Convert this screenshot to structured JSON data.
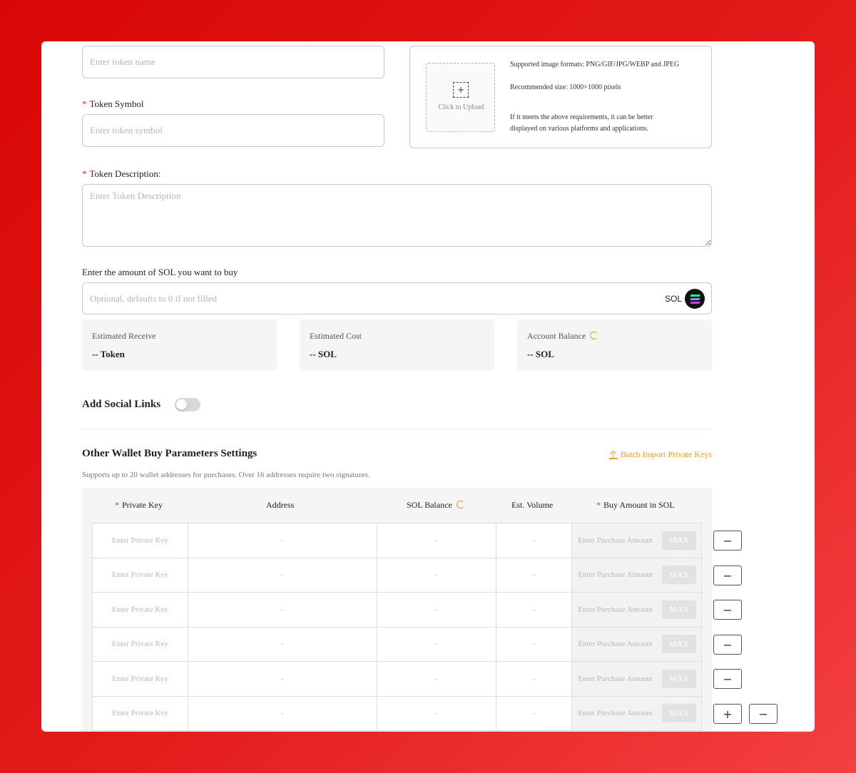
{
  "token_name": {
    "placeholder": "Enter token name"
  },
  "token_symbol": {
    "label": "Token Symbol",
    "placeholder": "Enter token symbol"
  },
  "upload": {
    "label": "Click to Upload",
    "formats": "Supported image formats: PNG/GIF/JPG/WEBP and JPEG",
    "size": "Recommended size: 1000×1000 pixels",
    "note": "If it meets the above requirements, it can be better displayed on various platforms and applications."
  },
  "token_description": {
    "label": "Token Description:",
    "placeholder": "Enter Token Description"
  },
  "sol_amount": {
    "label": "Enter the amount of SOL you want to buy",
    "placeholder": "Optional, defaults to 0 if not filled",
    "suffix": "SOL"
  },
  "stats": [
    {
      "label": "Estimated Receive",
      "value": "-- Token"
    },
    {
      "label": "Estimated Cost",
      "value": "-- SOL"
    },
    {
      "label": "Account Balance",
      "value": "-- SOL"
    }
  ],
  "social": {
    "label": "Add Social Links",
    "enabled": false
  },
  "wallets": {
    "title": "Other Wallet Buy Parameters Settings",
    "batch_import": "Batch Import Private Keys",
    "subtitle": "Supports up to 20 wallet addresses for purchases. Over 16 addresses require two signatures.",
    "headers": {
      "private_key": "Private Key",
      "address": "Address",
      "sol_balance": "SOL Balance",
      "est_volume": "Est. Volume",
      "buy_amount": "Buy Amount in SOL"
    },
    "row_placeholder_key": "Enter Private Key",
    "row_placeholder_amount": "Enter Purchase Amount",
    "max_label": "MAX",
    "empty_value": "-",
    "minus_label": "−",
    "plus_label": "+"
  },
  "colors": {
    "accent": "#f29b1d",
    "required": "#e0302a",
    "background": "#d80707"
  }
}
